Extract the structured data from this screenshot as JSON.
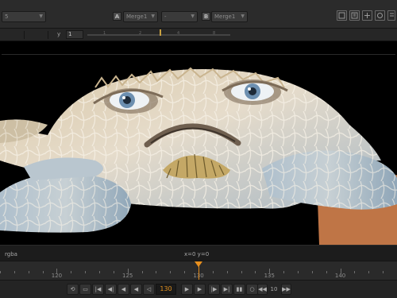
{
  "toolbar": {
    "channel_field": "5",
    "input_a_badge": "A",
    "input_a_node": "Merge1",
    "operation": "-",
    "input_b_badge": "B",
    "input_b_node": "Merge1",
    "icons": [
      "roi-icon",
      "lut-icon",
      "grid-icon",
      "overlay-icon",
      "zoom-icon"
    ]
  },
  "toolbar2": {
    "y_label": "y",
    "y_value": "1",
    "slider_ticks": [
      "1",
      "2",
      "4",
      "8"
    ]
  },
  "viewer": {
    "content": "crab-creature-image"
  },
  "infobar": {
    "channels": "rgba",
    "coordinates": "x=0 y=0"
  },
  "timeline": {
    "current_frame": 130,
    "labels": [
      "120",
      "125",
      "130",
      "135",
      "140"
    ],
    "range_start": 116,
    "range_end": 144
  },
  "transport": {
    "frame": "130",
    "step": "10",
    "buttons": [
      "loop-icon",
      "first-frame-icon",
      "prev-keyframe-icon",
      "step-back-icon",
      "play-backward-icon",
      "play-forward-icon",
      "step-forward-icon",
      "next-keyframe-icon",
      "last-frame-icon",
      "stop-icon",
      "step-back-n-icon",
      "step-forward-n-icon"
    ]
  }
}
